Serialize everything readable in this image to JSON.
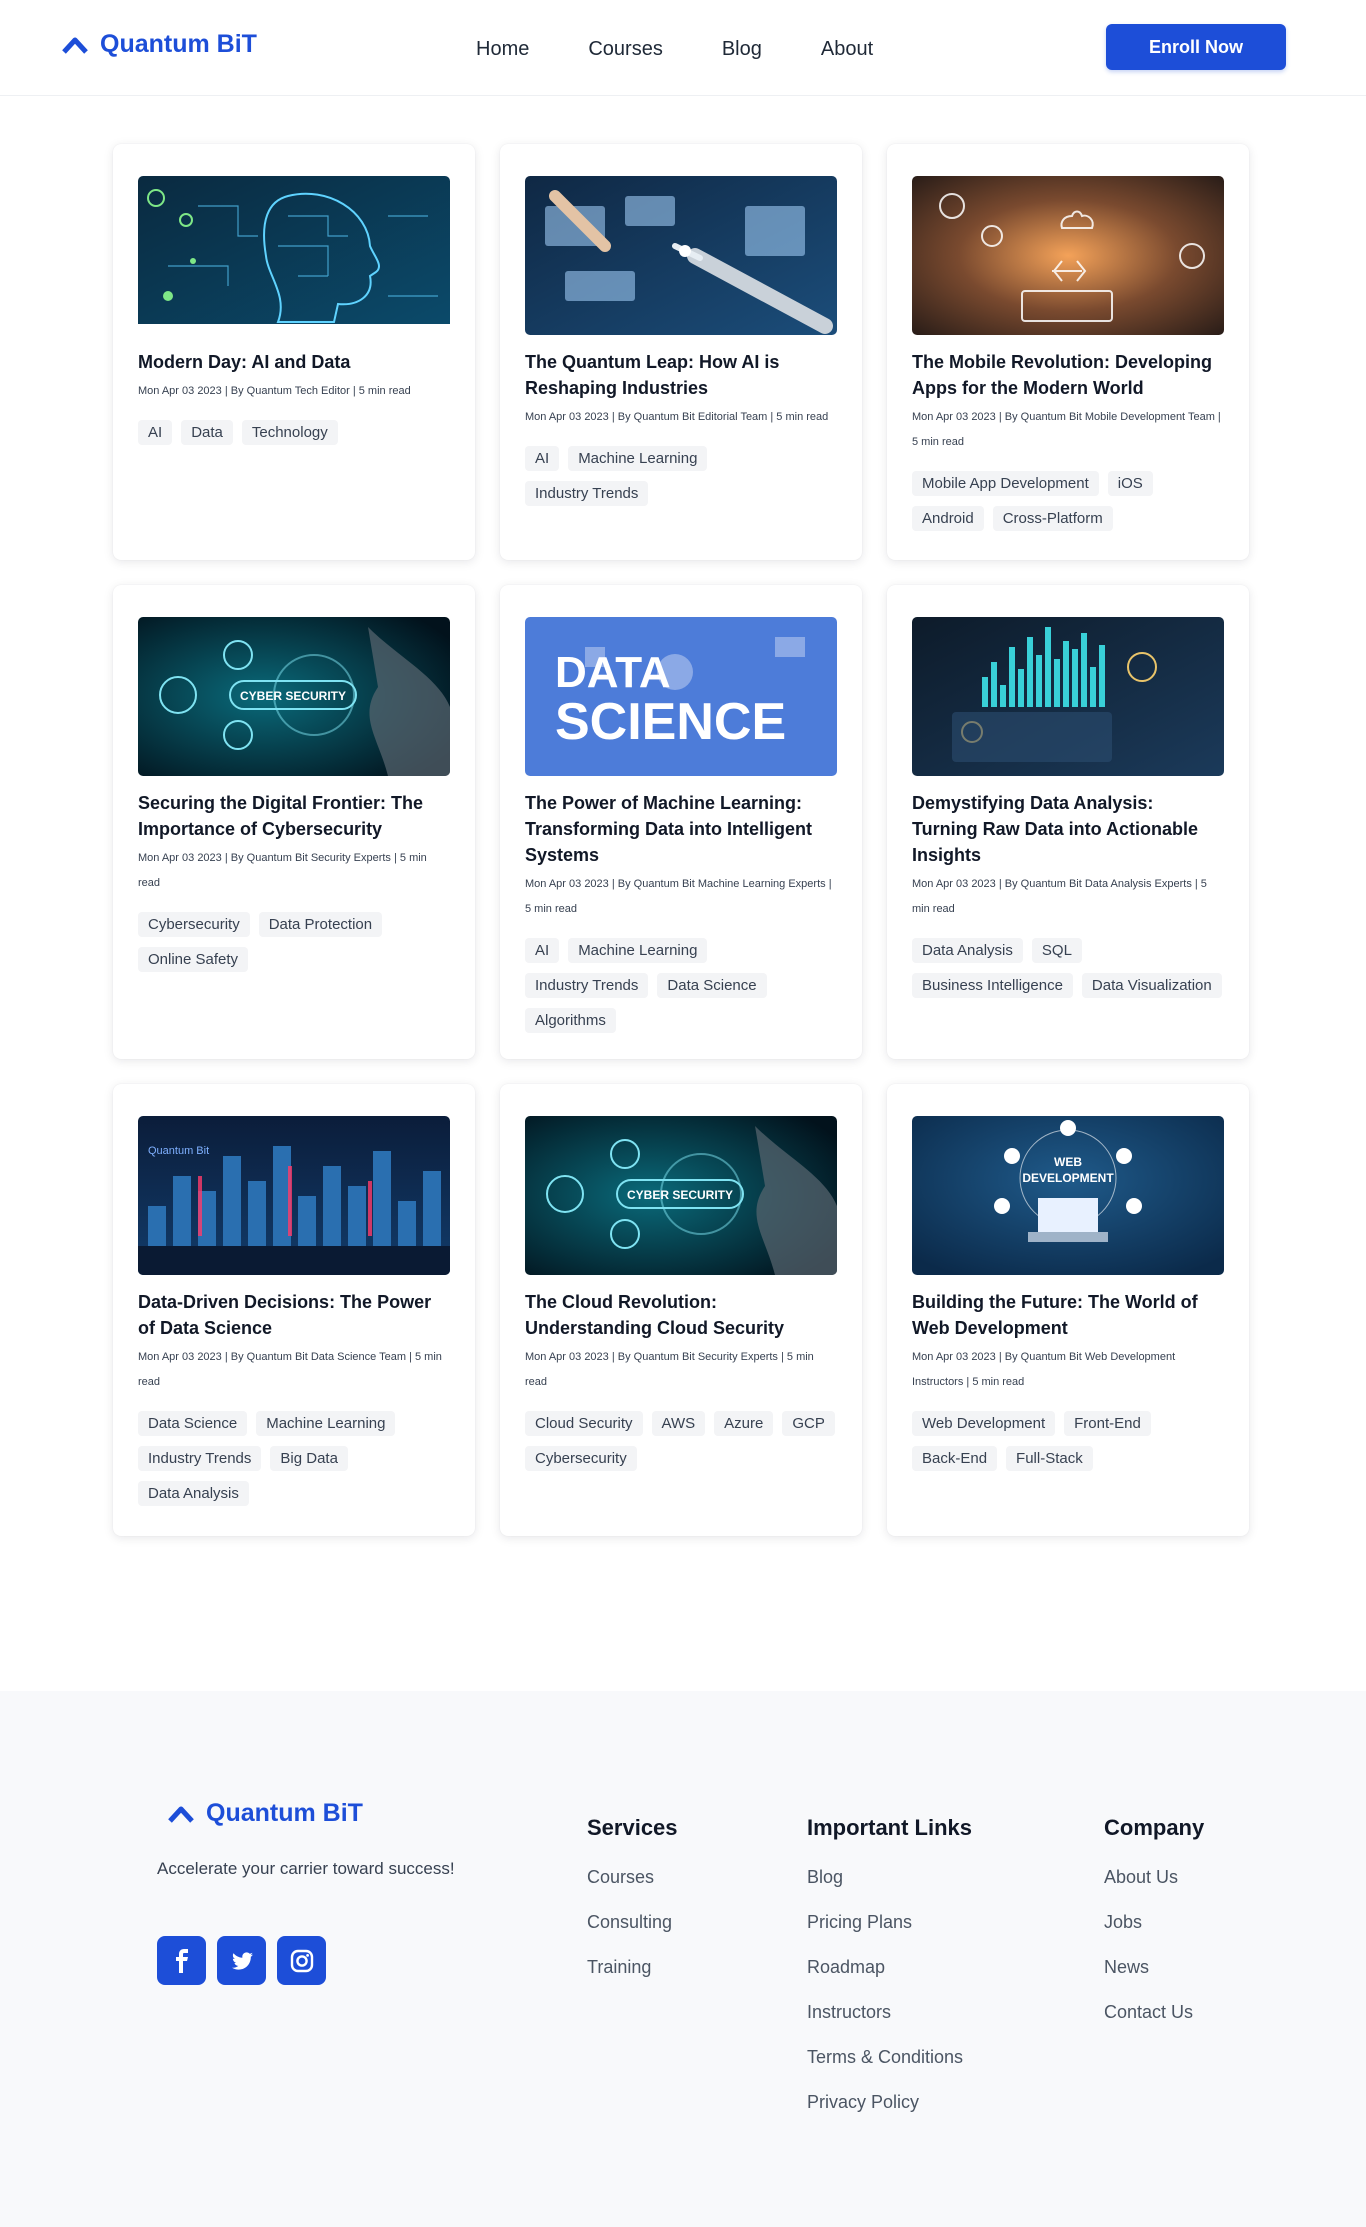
{
  "header": {
    "brand": "Quantum BiT",
    "nav": [
      "Home",
      "Courses",
      "Blog",
      "About"
    ],
    "cta": "Enroll Now"
  },
  "posts": [
    {
      "title": "Modern Day: AI and Data",
      "meta": "Mon Apr 03 2023 | By Quantum Tech Editor | 5 min read",
      "tags": [
        "AI",
        "Data",
        "Technology"
      ],
      "image": "ai-head-circuit"
    },
    {
      "title": "The Quantum Leap: How AI is Reshaping Industries",
      "meta": "Mon Apr 03 2023 | By Quantum Bit Editorial Team | 5 min read",
      "tags": [
        "AI",
        "Machine Learning",
        "Industry Trends"
      ],
      "image": "robot-hand"
    },
    {
      "title": "The Mobile Revolution: Developing Apps for the Modern World",
      "meta": "Mon Apr 03 2023 | By Quantum Bit Mobile Development Team | 5 min read",
      "tags": [
        "Mobile App Development",
        "iOS",
        "Android",
        "Cross-Platform"
      ],
      "image": "mobile-laptop"
    },
    {
      "title": "Securing the Digital Frontier: The Importance of Cybersecurity",
      "meta": "Mon Apr 03 2023 | By Quantum Bit Security Experts | 5 min read",
      "tags": [
        "Cybersecurity",
        "Data Protection",
        "Online Safety"
      ],
      "image": "cyber-security",
      "image_text": "CYBER SECURITY"
    },
    {
      "title": "The Power of Machine Learning: Transforming Data into Intelligent Systems",
      "meta": "Mon Apr 03 2023 | By Quantum Bit Machine Learning Experts | 5 min read",
      "tags": [
        "AI",
        "Machine Learning",
        "Industry Trends",
        "Data Science",
        "Algorithms"
      ],
      "image": "data-science",
      "image_text": [
        "DATA",
        "SCIENCE"
      ]
    },
    {
      "title": "Demystifying Data Analysis: Turning Raw Data into Actionable Insights",
      "meta": "Mon Apr 03 2023 | By Quantum Bit Data Analysis Experts | 5 min read",
      "tags": [
        "Data Analysis",
        "SQL",
        "Business Intelligence",
        "Data Visualization"
      ],
      "image": "data-dashboard"
    },
    {
      "title": "Data-Driven Decisions: The Power of Data Science",
      "meta": "Mon Apr 03 2023 | By Quantum Bit Data Science Team | 5 min read",
      "tags": [
        "Data Science",
        "Machine Learning",
        "Industry Trends",
        "Big Data",
        "Data Analysis"
      ],
      "image": "city-data",
      "image_text": "Quantum Bit"
    },
    {
      "title": "The Cloud Revolution: Understanding Cloud Security",
      "meta": "Mon Apr 03 2023 | By Quantum Bit Security Experts | 5 min read",
      "tags": [
        "Cloud Security",
        "AWS",
        "Azure",
        "GCP",
        "Cybersecurity"
      ],
      "image": "cyber-security",
      "image_text": "CYBER SECURITY"
    },
    {
      "title": "Building the Future: The World of Web Development",
      "meta": "Mon Apr 03 2023 | By Quantum Bit Web Development Instructors | 5 min read",
      "tags": [
        "Web Development",
        "Front-End",
        "Back-End",
        "Full-Stack"
      ],
      "image": "web-dev",
      "image_text": [
        "WEB",
        "DEVELOPMENT"
      ]
    }
  ],
  "footer": {
    "brand": "Quantum BiT",
    "tagline": "Accelerate your carrier toward success!",
    "socials": [
      "facebook-icon",
      "twitter-icon",
      "instagram-icon"
    ],
    "services": {
      "title": "Services",
      "links": [
        "Courses",
        "Consulting",
        "Training"
      ]
    },
    "important": {
      "title": "Important Links",
      "links": [
        "Blog",
        "Pricing Plans",
        "Roadmap",
        "Instructors",
        "Terms & Conditions",
        "Privacy Policy"
      ]
    },
    "company": {
      "title": "Company",
      "links": [
        "About Us",
        "Jobs",
        "News",
        "Contact Us"
      ]
    }
  },
  "colors": {
    "brand": "#1d4ed8",
    "tag_bg": "#f3f4f6",
    "footer_bg": "#f8f9fb"
  }
}
